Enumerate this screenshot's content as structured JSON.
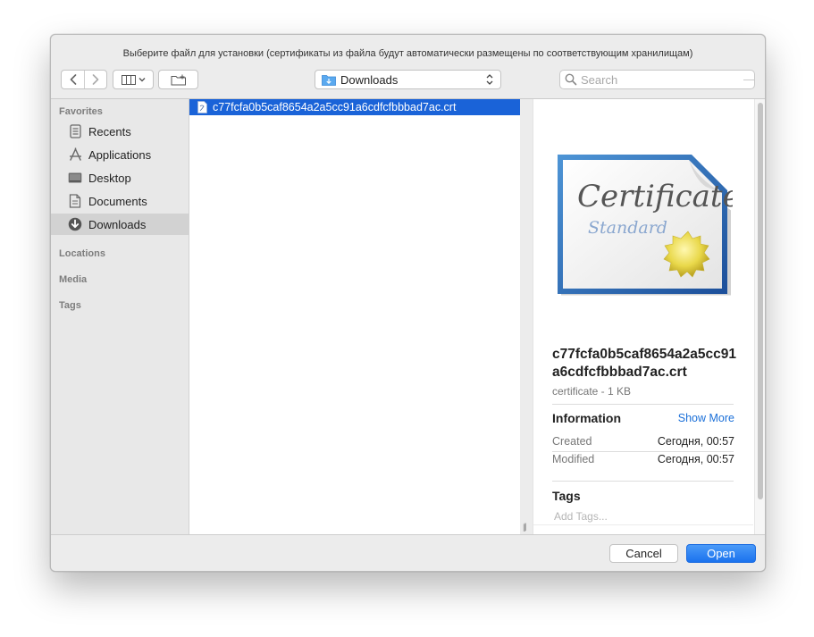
{
  "dialog": {
    "title": "Выберите файл для установки (сертификаты из файла будут автоматически размещены по соответствующим хранилищам)"
  },
  "toolbar": {
    "location": "Downloads",
    "search_placeholder": "Search"
  },
  "sidebar": {
    "favorites_header": "Favorites",
    "items": [
      {
        "label": "Recents",
        "icon": "recents-icon",
        "selected": false
      },
      {
        "label": "Applications",
        "icon": "applications-icon",
        "selected": false
      },
      {
        "label": "Desktop",
        "icon": "desktop-icon",
        "selected": false
      },
      {
        "label": "Documents",
        "icon": "documents-icon",
        "selected": false
      },
      {
        "label": "Downloads",
        "icon": "downloads-icon",
        "selected": true
      }
    ],
    "locations_header": "Locations",
    "media_header": "Media",
    "tags_header": "Tags"
  },
  "files": [
    {
      "name": "c77fcfa0b5caf8654a2a5cc91a6cdfcfbbbad7ac.crt",
      "selected": true
    }
  ],
  "preview": {
    "cert_title": "Certificate",
    "cert_subtitle": "Standard",
    "file_name": "c77fcfa0b5caf8654a2a5cc91a6cdfcfbbbad7ac.crt",
    "kind": "certificate - 1 KB",
    "information_header": "Information",
    "show_more": "Show More",
    "created_label": "Created",
    "created_value": "Сегодня, 00:57",
    "modified_label": "Modified",
    "modified_value": "Сегодня, 00:57",
    "tags_header": "Tags",
    "add_tags_placeholder": "Add Tags..."
  },
  "footer": {
    "cancel_label": "Cancel",
    "open_label": "Open"
  },
  "colors": {
    "accent": "#1a63d8",
    "link": "#1a6fd8"
  }
}
